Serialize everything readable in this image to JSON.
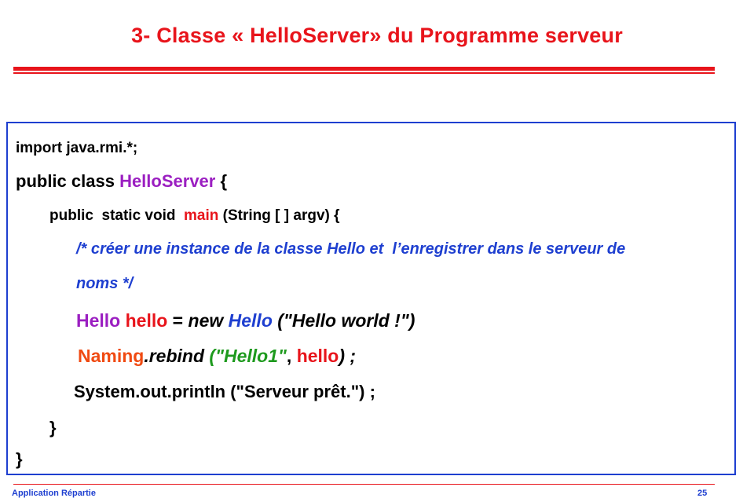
{
  "slide": {
    "title": "3- Classe « HelloServer» du Programme serveur"
  },
  "code": {
    "l1": "import java.rmi.*;",
    "l2_a": "public class ",
    "l2_b": "HelloServer",
    "l2_c": " {",
    "l3_a": "public  static void  ",
    "l3_b": "main",
    "l3_c": " (String [ ] argv) {",
    "l4": "/* créer une instance de la classe Hello et  l’enregistrer dans le serveur de",
    "l5": "noms */",
    "l6_a": "Hello ",
    "l6_b": "hello",
    "l6_c": " = ",
    "l6_d": "new ",
    "l6_e": "Hello",
    "l6_f": " (\"Hello world !\")",
    "l7_a": "Naming",
    "l7_b": ".rebind",
    "l7_c": " (\"Hello1\"",
    "l7_d": ", ",
    "l7_e": "hello",
    "l7_f": ") ;",
    "l8": "System.out.println (\"Serveur prêt.\") ;",
    "l9": "}",
    "l10": "}"
  },
  "footer": {
    "left": "Application Répartie",
    "right": "25"
  },
  "colors": {
    "title_red": "#e8141b",
    "box_blue": "#1e3fd0",
    "class_purple": "#9b1fc1",
    "string_green": "#1e9a1e",
    "naming_orange": "#f04a12"
  }
}
